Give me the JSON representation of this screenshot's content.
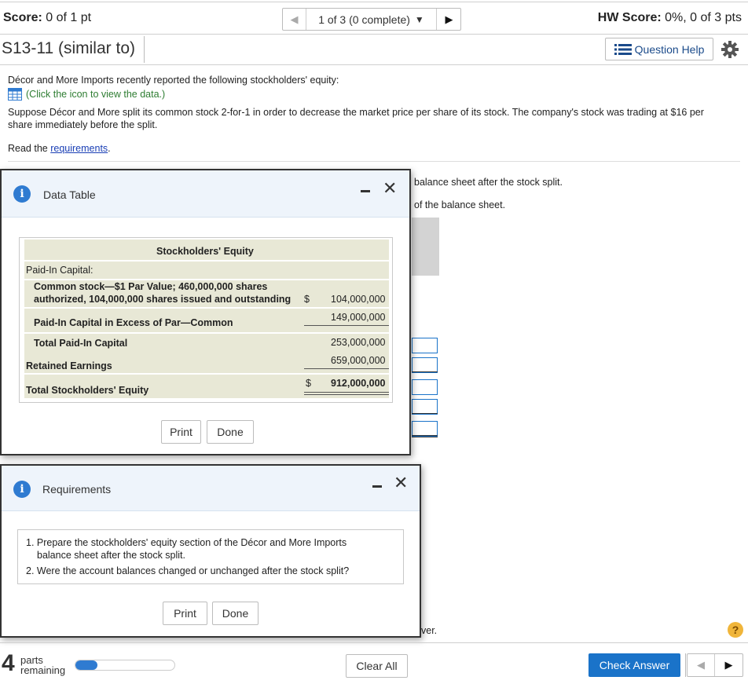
{
  "header": {
    "score_label": "Score:",
    "score_value": "0 of 1 pt",
    "nav_position": "1 of 3 (0 complete)",
    "hw_score_label": "HW Score:",
    "hw_score_value": "0%, 0 of 3 pts",
    "question_title": "S13-11 (similar to)",
    "question_help_label": "Question Help"
  },
  "question": {
    "intro": "Décor and More Imports recently reported the following stockholders' equity:",
    "data_link": "(Click the icon to view the data.)",
    "prompt": "Suppose Décor and More split its common stock 2-for-1 in order to decrease the market price per share of its stock. The company's stock was trading at $16 per share immediately before the split.",
    "read_prefix": "Read the ",
    "read_link": "requirements",
    "read_suffix": ".",
    "bg_line1": "balance sheet after the stock split.",
    "bg_line2": "of the balance sheet.",
    "bg_line3": "ver."
  },
  "data_table_dialog": {
    "title": "Data Table",
    "table_title": "Stockholders' Equity",
    "section_label": "Paid-In Capital:",
    "common_stock_line1": "Common stock—$1 Par Value; 460,000,000 shares",
    "common_stock_line2": "authorized, 104,000,000 shares issued and outstanding",
    "common_stock_currency": "$",
    "common_stock_value": "104,000,000",
    "apic_label": "Paid-In Capital in Excess of Par—Common",
    "apic_value": "149,000,000",
    "total_pic_label": "Total Paid-In Capital",
    "total_pic_value": "253,000,000",
    "retained_label": "Retained Earnings",
    "retained_value": "659,000,000",
    "total_se_label": "Total Stockholders' Equity",
    "total_se_currency": "$",
    "total_se_value": "912,000,000",
    "print_label": "Print",
    "done_label": "Done"
  },
  "requirements_dialog": {
    "title": "Requirements",
    "item1": "1. Prepare the stockholders' equity section of the Décor and More Imports",
    "item1b": "balance sheet after the stock split.",
    "item2": "2. Were the account balances changed or unchanged after the stock split?",
    "print_label": "Print",
    "done_label": "Done"
  },
  "footer": {
    "parts_count": "4",
    "parts_line1": "parts",
    "parts_line2": "remaining",
    "progress_fraction": 0.22,
    "clear_all_label": "Clear All",
    "check_answer_label": "Check Answer"
  },
  "colors": {
    "accent": "#1a73c9",
    "info_icon": "#2f7bd1",
    "table_bg": "#e8e8d6",
    "help_icon": "#f0b53a"
  }
}
